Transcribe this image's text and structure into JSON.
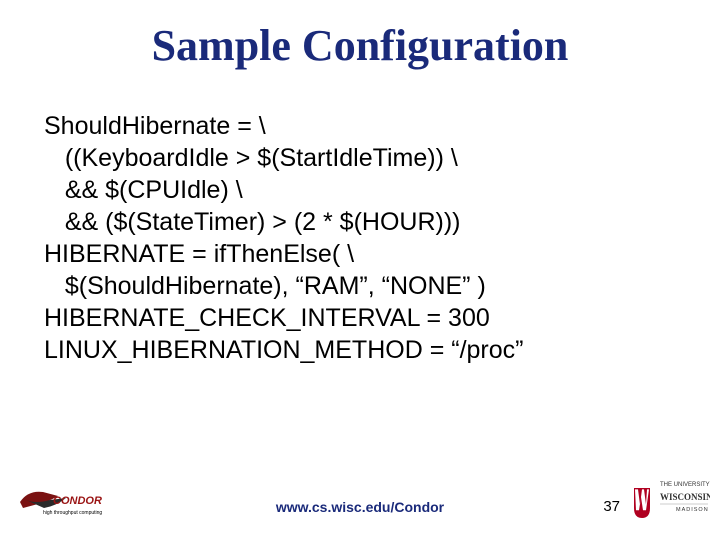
{
  "title": "Sample Configuration",
  "body_lines": [
    "ShouldHibernate = \\",
    "   ((KeyboardIdle > $(StartIdleTime)) \\",
    "   && $(CPUIdle) \\",
    "   && ($(StateTimer) > (2 * $(HOUR)))",
    "HIBERNATE = ifThenElse( \\",
    "   $(ShouldHibernate), “RAM”, “NONE” )",
    "HIBERNATE_CHECK_INTERVAL = 300",
    "LINUX_HIBERNATION_METHOD = “/proc”"
  ],
  "footer_url": "www.cs.wisc.edu/Condor",
  "page_number": "37",
  "condor_logo_label": "CONDOR",
  "condor_logo_sub": "high throughput computing",
  "uw_logo_top": "THE UNIVERSITY",
  "uw_logo_bottom": "WISCONSIN",
  "uw_logo_sub": "MADISON"
}
